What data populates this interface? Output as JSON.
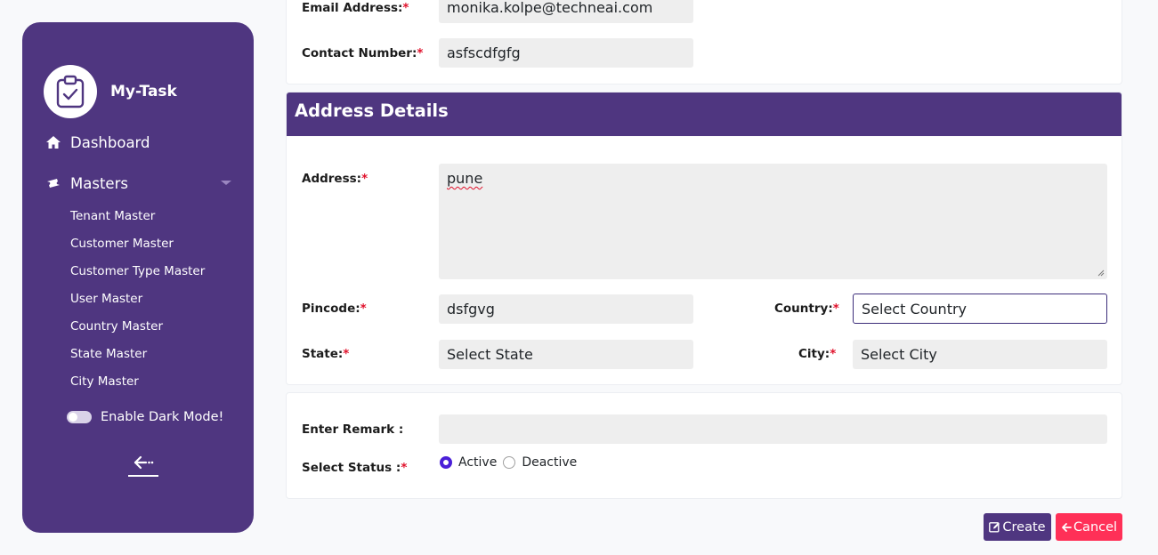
{
  "sidebar": {
    "brand": {
      "name": "My-Task",
      "icon": "clipboard-check-icon"
    },
    "nav": {
      "dashboard": {
        "label": "Dashboard",
        "icon": "home-icon"
      },
      "masters": {
        "label": "Masters",
        "icon": "ticket-icon",
        "items": [
          {
            "label": "Tenant Master"
          },
          {
            "label": "Customer Master"
          },
          {
            "label": "Customer Type Master"
          },
          {
            "label": "User Master"
          },
          {
            "label": "Country Master"
          },
          {
            "label": "State Master"
          },
          {
            "label": "City Master"
          }
        ]
      }
    },
    "dark_mode": {
      "label": "Enable Dark Mode!",
      "enabled": false
    },
    "logout_icon": "logout-icon"
  },
  "contact": {
    "email": {
      "label": "Email Address:",
      "required": "*",
      "value": "monika.kolpe@techneai.com"
    },
    "phone": {
      "label": "Contact Number:",
      "required": "*",
      "value": "asfscdfgfg"
    }
  },
  "address": {
    "title": "Address Details",
    "address": {
      "label": "Address:",
      "required": "*",
      "value": "pune"
    },
    "pincode": {
      "label": "Pincode:",
      "required": "*",
      "value": "dsfgvg"
    },
    "country": {
      "label": "Country:",
      "required": "*",
      "value": "Select Country"
    },
    "state": {
      "label": "State:",
      "required": "*",
      "value": "Select State"
    },
    "city": {
      "label": "City:",
      "required": "*",
      "value": "Select City"
    }
  },
  "status": {
    "remark": {
      "label": "Enter Remark :",
      "value": ""
    },
    "select_status": {
      "label": "Select Status :",
      "required": "*"
    },
    "options": [
      {
        "label": "Active",
        "checked": true
      },
      {
        "label": "Deactive",
        "checked": false
      }
    ]
  },
  "actions": {
    "create": {
      "label": "Create",
      "icon": "edit-icon"
    },
    "cancel": {
      "label": "Cancel",
      "icon": "arrow-left-icon"
    }
  },
  "colors": {
    "primary": "#4f3680",
    "danger": "#ff3057",
    "required": "#e0112b",
    "radio": "#4a1fd8"
  }
}
